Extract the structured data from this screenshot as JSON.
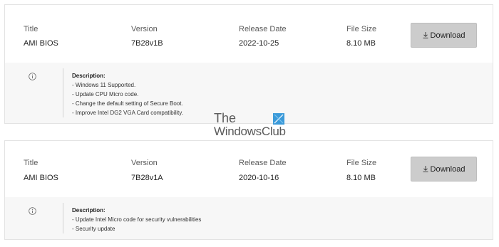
{
  "headers": {
    "title": "Title",
    "version": "Version",
    "release_date": "Release Date",
    "file_size": "File Size"
  },
  "download_label": "Download",
  "description_heading": "Description:",
  "entries": [
    {
      "title": "AMI BIOS",
      "version": "7B28v1B",
      "release_date": "2022-10-25",
      "file_size": "8.10 MB",
      "description": [
        "- Windows 11 Supported.",
        "- Update CPU Micro code.",
        "- Change the default setting of Secure Boot.",
        "- Improve Intel DG2 VGA Card compatibility."
      ]
    },
    {
      "title": "AMI BIOS",
      "version": "7B28v1A",
      "release_date": "2020-10-16",
      "file_size": "8.10 MB",
      "description": [
        "- Update Intel Micro code for security vulnerabilities",
        "- Security update"
      ]
    }
  ],
  "watermark": {
    "line1": "The",
    "line2": "WindowsClub"
  },
  "icons": {
    "info": "info-circle-icon",
    "download": "download-arrow-icon"
  },
  "colors": {
    "button_bg": "#cccccc",
    "description_bg": "#f7f7f7",
    "border": "#e3e3e3",
    "logo_blue": "#3b9ad9"
  }
}
